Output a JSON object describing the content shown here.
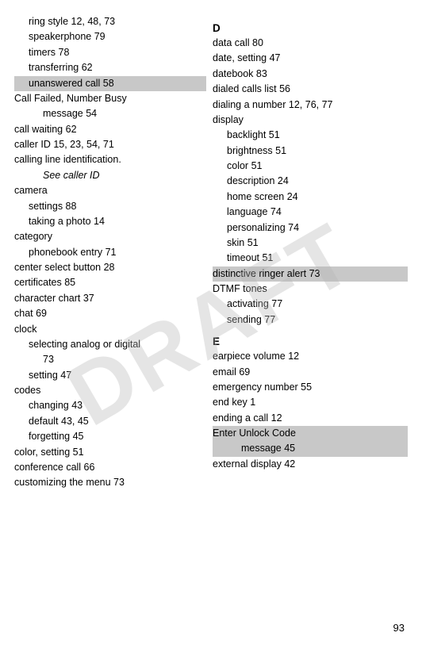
{
  "watermark": "DRAFT",
  "page_number": "93",
  "left_column": [
    {
      "type": "entry",
      "indent": "sub",
      "text": "ring style  12, 48, 73"
    },
    {
      "type": "entry",
      "indent": "sub",
      "text": "speakerphone  79"
    },
    {
      "type": "entry",
      "indent": "sub",
      "text": "timers  78"
    },
    {
      "type": "entry",
      "indent": "sub",
      "text": "transferring  62"
    },
    {
      "type": "entry",
      "indent": "sub",
      "highlight": true,
      "text": "unanswered call  58"
    },
    {
      "type": "entry",
      "indent": "main",
      "text": "Call Failed, Number Busy"
    },
    {
      "type": "entry",
      "indent": "sub-sub",
      "text": "message  54"
    },
    {
      "type": "entry",
      "indent": "main",
      "text": "call waiting  62"
    },
    {
      "type": "entry",
      "indent": "main",
      "text": "caller ID  15, 23, 54, 71"
    },
    {
      "type": "entry",
      "indent": "main",
      "text": "calling line identification."
    },
    {
      "type": "entry",
      "indent": "sub-sub",
      "see": true,
      "text": "See caller ID"
    },
    {
      "type": "entry",
      "indent": "main",
      "text": "camera"
    },
    {
      "type": "entry",
      "indent": "sub",
      "text": "settings  88"
    },
    {
      "type": "entry",
      "indent": "sub",
      "text": "taking a photo  14"
    },
    {
      "type": "entry",
      "indent": "main",
      "text": "category"
    },
    {
      "type": "entry",
      "indent": "sub",
      "text": "phonebook entry  71"
    },
    {
      "type": "entry",
      "indent": "main",
      "text": "center select button  28"
    },
    {
      "type": "entry",
      "indent": "main",
      "text": "certificates  85"
    },
    {
      "type": "entry",
      "indent": "main",
      "text": "character chart  37"
    },
    {
      "type": "entry",
      "indent": "main",
      "text": "chat  69"
    },
    {
      "type": "entry",
      "indent": "main",
      "text": "clock"
    },
    {
      "type": "entry",
      "indent": "sub",
      "text": "selecting analog or digital"
    },
    {
      "type": "entry",
      "indent": "sub-sub",
      "text": "73"
    },
    {
      "type": "entry",
      "indent": "sub",
      "text": "setting  47"
    },
    {
      "type": "entry",
      "indent": "main",
      "text": "codes"
    },
    {
      "type": "entry",
      "indent": "sub",
      "text": "changing  43"
    },
    {
      "type": "entry",
      "indent": "sub",
      "text": "default  43, 45"
    },
    {
      "type": "entry",
      "indent": "sub",
      "text": "forgetting  45"
    },
    {
      "type": "entry",
      "indent": "main",
      "text": "color, setting  51"
    },
    {
      "type": "entry",
      "indent": "main",
      "text": "conference call  66"
    },
    {
      "type": "entry",
      "indent": "main",
      "text": "customizing the menu  73"
    }
  ],
  "right_column": [
    {
      "type": "section",
      "letter": "D"
    },
    {
      "type": "entry",
      "indent": "main",
      "text": "data call  80"
    },
    {
      "type": "entry",
      "indent": "main",
      "text": "date, setting  47"
    },
    {
      "type": "entry",
      "indent": "main",
      "text": "datebook  83"
    },
    {
      "type": "entry",
      "indent": "main",
      "text": "dialed calls list  56"
    },
    {
      "type": "entry",
      "indent": "main",
      "text": "dialing a number  12, 76, 77"
    },
    {
      "type": "entry",
      "indent": "main",
      "text": "display"
    },
    {
      "type": "entry",
      "indent": "sub",
      "text": "backlight  51"
    },
    {
      "type": "entry",
      "indent": "sub",
      "text": "brightness  51"
    },
    {
      "type": "entry",
      "indent": "sub",
      "text": "color  51"
    },
    {
      "type": "entry",
      "indent": "sub",
      "text": "description  24"
    },
    {
      "type": "entry",
      "indent": "sub",
      "text": "home screen  24"
    },
    {
      "type": "entry",
      "indent": "sub",
      "text": "language  74"
    },
    {
      "type": "entry",
      "indent": "sub",
      "text": "personalizing  74"
    },
    {
      "type": "entry",
      "indent": "sub",
      "text": "skin  51"
    },
    {
      "type": "entry",
      "indent": "sub",
      "text": "timeout  51"
    },
    {
      "type": "entry",
      "indent": "main",
      "highlight": true,
      "text": "distinctive ringer alert  73"
    },
    {
      "type": "entry",
      "indent": "main",
      "text": "DTMF tones"
    },
    {
      "type": "entry",
      "indent": "sub",
      "text": "activating  77"
    },
    {
      "type": "entry",
      "indent": "sub",
      "text": "sending  77"
    },
    {
      "type": "section",
      "letter": "E"
    },
    {
      "type": "entry",
      "indent": "main",
      "text": "earpiece volume  12"
    },
    {
      "type": "entry",
      "indent": "main",
      "text": "email  69"
    },
    {
      "type": "entry",
      "indent": "main",
      "text": "emergency number  55"
    },
    {
      "type": "entry",
      "indent": "main",
      "text": "end key  1"
    },
    {
      "type": "entry",
      "indent": "main",
      "text": "ending a call  12"
    },
    {
      "type": "entry",
      "indent": "main",
      "highlight": true,
      "text": "Enter Unlock Code"
    },
    {
      "type": "entry",
      "indent": "sub-sub",
      "highlight": true,
      "text": "message  45"
    },
    {
      "type": "entry",
      "indent": "main",
      "text": "external display  42"
    }
  ]
}
